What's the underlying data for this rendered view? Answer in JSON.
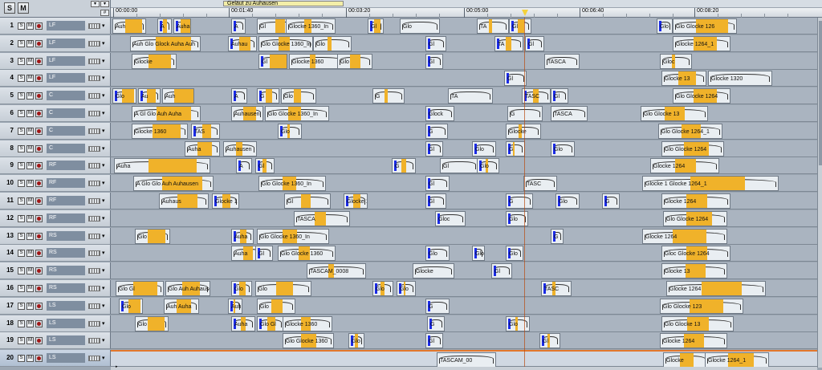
{
  "header": {
    "solo_label": "S",
    "mute_label": "M",
    "range_name": "Geläut zu Auhausen",
    "end_marker": "0"
  },
  "ruler": {
    "labels": [
      "00:00:00",
      "00:01:40",
      "00:03:20",
      "00:05:00",
      "00:06:40",
      "00:08:20"
    ]
  },
  "tracks": [
    {
      "num": "1",
      "name": "LF",
      "clips": [
        {
          "label": "Auh"
        },
        {
          "label": "A"
        },
        {
          "label": "Auha"
        },
        {
          "label": "A"
        },
        {
          "label": "Gl"
        },
        {
          "label": "Glocke 1360_In"
        },
        {
          "label": "Gl"
        },
        {
          "label": "Glo"
        },
        {
          "label": "TA"
        },
        {
          "label": "Gl"
        },
        {
          "label": "Glo"
        },
        {
          "label": "Glo Glocke 126"
        }
      ]
    },
    {
      "num": "2",
      "name": "LF",
      "clips": [
        {
          "label": "Auh Glo Glock Auha Auh"
        },
        {
          "label": "Auhau"
        },
        {
          "label": "Glo Glocke 1360_In"
        },
        {
          "label": "Glo"
        },
        {
          "label": "Gl"
        },
        {
          "label": "TA"
        },
        {
          "label": "Gl"
        },
        {
          "label": "Glocke 1264_1"
        }
      ]
    },
    {
      "num": "3",
      "name": "LF",
      "clips": [
        {
          "label": "Glocke"
        },
        {
          "label": "Gl"
        },
        {
          "label": "Glocke 1360"
        },
        {
          "label": "Glo"
        },
        {
          "label": "Gl"
        },
        {
          "label": "TASCA"
        },
        {
          "label": "Gloc"
        }
      ]
    },
    {
      "num": "4",
      "name": "LF",
      "clips": [
        {
          "label": "Gl"
        },
        {
          "label": "Glocke 13"
        },
        {
          "label": "Glocke 1320"
        }
      ]
    },
    {
      "num": "5",
      "name": "C",
      "clips": [
        {
          "label": "Glo"
        },
        {
          "label": "Au"
        },
        {
          "label": "Auh"
        },
        {
          "label": "A"
        },
        {
          "label": "G"
        },
        {
          "label": "Glo"
        },
        {
          "label": "G"
        },
        {
          "label": "TA"
        },
        {
          "label": "TASC"
        },
        {
          "label": "Gl"
        },
        {
          "label": "Glo Glocke 1264"
        }
      ]
    },
    {
      "num": "6",
      "name": "C",
      "clips": [
        {
          "label": "A Gl Glo Auh Auha"
        },
        {
          "label": "Auhausen"
        },
        {
          "label": "Glo Glocke 1360_In"
        },
        {
          "label": "Glock"
        },
        {
          "label": "G"
        },
        {
          "label": "TASCA"
        },
        {
          "label": "Glo Glocke 13"
        }
      ]
    },
    {
      "num": "7",
      "name": "C",
      "clips": [
        {
          "label": "Glocke 1360"
        },
        {
          "label": "TAS"
        },
        {
          "label": "Glo"
        },
        {
          "label": "G"
        },
        {
          "label": "Glocke"
        },
        {
          "label": "Glo Glocke 1264_1"
        }
      ]
    },
    {
      "num": "8",
      "name": "C",
      "clips": [
        {
          "label": "Auha"
        },
        {
          "label": "Auhausen"
        },
        {
          "label": "Gl"
        },
        {
          "label": "Glo"
        },
        {
          "label": "G"
        },
        {
          "label": "Glo"
        },
        {
          "label": "Glo Glocke 1264"
        }
      ]
    },
    {
      "num": "9",
      "name": "RF",
      "clips": [
        {
          "label": "Auha"
        },
        {
          "label": "A"
        },
        {
          "label": "Gl"
        },
        {
          "label": "G"
        },
        {
          "label": "Gl"
        },
        {
          "label": "Glo"
        },
        {
          "label": "Glocke 1264"
        }
      ]
    },
    {
      "num": "10",
      "name": "RF",
      "clips": [
        {
          "label": "A Glo Glo Auh Auhausen"
        },
        {
          "label": "Glo Glocke 1360_In"
        },
        {
          "label": "Gl"
        },
        {
          "label": "TASC"
        },
        {
          "label": "Glocke 1 Glocke 1264_1"
        }
      ]
    },
    {
      "num": "11",
      "name": "RF",
      "clips": [
        {
          "label": "Auhaus"
        },
        {
          "label": "Glocke 1"
        },
        {
          "label": "Gl"
        },
        {
          "label": "Glocke 1360"
        },
        {
          "label": "Gl"
        },
        {
          "label": "G"
        },
        {
          "label": "Glo"
        },
        {
          "label": "G"
        },
        {
          "label": "Glocke 1264"
        }
      ]
    },
    {
      "num": "12",
      "name": "RF",
      "clips": [
        {
          "label": "TASCA"
        },
        {
          "label": "Gloc"
        },
        {
          "label": "Glo"
        },
        {
          "label": "Glo Glocke 1264"
        }
      ]
    },
    {
      "num": "13",
      "name": "RS",
      "clips": [
        {
          "label": "Glo"
        },
        {
          "label": "Auha"
        },
        {
          "label": "Glo Glocke 1360_In"
        },
        {
          "label": "G"
        },
        {
          "label": "Glocke 1264"
        }
      ]
    },
    {
      "num": "14",
      "name": "RS",
      "clips": [
        {
          "label": "Auha"
        },
        {
          "label": "Gl"
        },
        {
          "label": "Glo Glocke 1360"
        },
        {
          "label": "Glo"
        },
        {
          "label": "Glo"
        },
        {
          "label": "Glo"
        },
        {
          "label": "Gloc Glocke 1264"
        }
      ]
    },
    {
      "num": "15",
      "name": "RS",
      "clips": [
        {
          "label": "TASCAM_0008"
        },
        {
          "label": "Glocke"
        },
        {
          "label": "Gl"
        },
        {
          "label": "Glocke 13"
        }
      ]
    },
    {
      "num": "16",
      "name": "RS",
      "clips": [
        {
          "label": "Glo Gl"
        },
        {
          "label": "Glo Auh Auhause"
        },
        {
          "label": "Glo"
        },
        {
          "label": "Glo"
        },
        {
          "label": "Glo"
        },
        {
          "label": "Glo"
        },
        {
          "label": "TASC"
        },
        {
          "label": "Glocke 1264"
        }
      ]
    },
    {
      "num": "17",
      "name": "LS",
      "clips": [
        {
          "label": "Glo"
        },
        {
          "label": "Auh Auha"
        },
        {
          "label": "Auh"
        },
        {
          "label": "Glo"
        },
        {
          "label": "G"
        },
        {
          "label": "Glo Glocke 123"
        }
      ]
    },
    {
      "num": "18",
      "name": "LS",
      "clips": [
        {
          "label": "Glo"
        },
        {
          "label": "Auha"
        },
        {
          "label": "Glo Gl"
        },
        {
          "label": "Glocke 1360"
        },
        {
          "label": "G"
        },
        {
          "label": "Glo"
        },
        {
          "label": "Glo Glocke 13"
        }
      ]
    },
    {
      "num": "19",
      "name": "LS",
      "clips": [
        {
          "label": "Glo Glocke 1360"
        },
        {
          "label": "Glo"
        },
        {
          "label": "Gl"
        },
        {
          "label": "Gl"
        },
        {
          "label": "Glocke 1264"
        }
      ]
    },
    {
      "num": "20",
      "name": "LS",
      "clips": [
        {
          "label": "TASCAM_00"
        },
        {
          "label": "Glocke"
        },
        {
          "label": "Glocke 1264_1"
        }
      ]
    }
  ]
}
